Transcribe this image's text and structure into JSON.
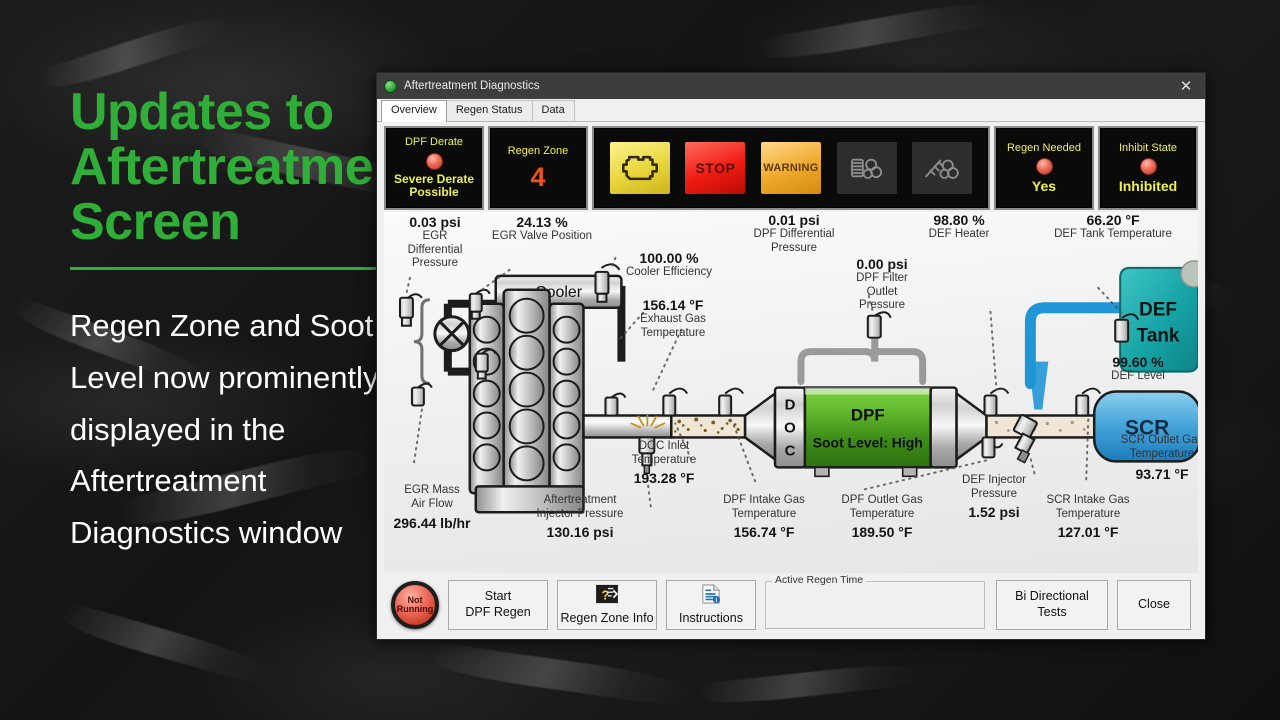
{
  "slide": {
    "headline_lines": [
      "Updates to",
      "Aftertreatment",
      "Screen"
    ],
    "body_lines": [
      "Regen Zone and Soot",
      "Level now prominently",
      "displayed in the",
      "Aftertreatment",
      "Diagnostics window"
    ],
    "accent_color": "#2fae38"
  },
  "window": {
    "title": "Aftertreatment Diagnostics",
    "close_label": "✕",
    "tabs": [
      {
        "label": "Overview",
        "active": true
      },
      {
        "label": "Regen Status",
        "active": false
      },
      {
        "label": "Data",
        "active": false
      }
    ]
  },
  "status_panels": {
    "dpf_derate": {
      "title": "DPF Derate",
      "value_line1": "Severe Derate",
      "value_line2": "Possible"
    },
    "regen_zone": {
      "title": "Regen Zone",
      "value": "4"
    },
    "regen_needed": {
      "title": "Regen Needed",
      "value": "Yes"
    },
    "inhibit_state": {
      "title": "Inhibit State",
      "value": "Inhibited"
    },
    "lamps": [
      {
        "name": "check-engine-lamp",
        "state": "on-yellow",
        "text": ""
      },
      {
        "name": "stop-lamp",
        "state": "on-red",
        "text": "STOP"
      },
      {
        "name": "warning-lamp",
        "state": "on-amber",
        "text": "WARNING"
      },
      {
        "name": "dpf-lamp",
        "state": "off",
        "text": ""
      },
      {
        "name": "high-exhaust-temp-lamp",
        "state": "off",
        "text": ""
      }
    ]
  },
  "diagram": {
    "component_labels": {
      "cooler": "Cooler",
      "doc": "DOC",
      "dpf": "DPF",
      "dpf_soot": "Soot Level: High",
      "scr": "SCR",
      "def_tank_line1": "DEF",
      "def_tank_line2": "Tank"
    },
    "readings": [
      {
        "id": "egr-differential-pressure",
        "value": "0.03 psi",
        "name": "EGR\nDifferential\nPressure"
      },
      {
        "id": "egr-valve-position",
        "value": "24.13 %",
        "name": "EGR Valve Position"
      },
      {
        "id": "cooler-efficiency",
        "value": "100.00 %",
        "name": "Cooler Efficiency"
      },
      {
        "id": "exhaust-gas-temperature",
        "value": "156.14 °F",
        "name": "Exhaust Gas\nTemperature"
      },
      {
        "id": "dpf-differential-pressure",
        "value": "0.01 psi",
        "name": "DPF Differential\nPressure"
      },
      {
        "id": "dpf-filter-outlet-pressure",
        "value": "0.00 psi",
        "name": "DPF Filter\nOutlet\nPressure"
      },
      {
        "id": "def-heater",
        "value": "98.80 %",
        "name": "DEF Heater"
      },
      {
        "id": "def-tank-temperature",
        "value": "66.20 °F",
        "name": "DEF Tank Temperature"
      },
      {
        "id": "def-level",
        "value": "99.60 %",
        "name": "DEF Level"
      },
      {
        "id": "egr-mass-air-flow",
        "value": "296.44 lb/hr",
        "name": "EGR Mass\nAir Flow"
      },
      {
        "id": "aftertreatment-injector-pressure",
        "value": "130.16 psi",
        "name": "Aftertreatment\nInjector Pressure"
      },
      {
        "id": "doc-inlet-temperature",
        "value": "193.28 °F",
        "name": "DOC Inlet\nTemperature"
      },
      {
        "id": "dpf-intake-gas-temperature",
        "value": "156.74 °F",
        "name": "DPF Intake Gas\nTemperature"
      },
      {
        "id": "dpf-outlet-gas-temperature",
        "value": "189.50 °F",
        "name": "DPF Outlet Gas\nTemperature"
      },
      {
        "id": "def-injector-pressure",
        "value": "1.52 psi",
        "name": "DEF Injector\nPressure"
      },
      {
        "id": "scr-intake-gas-temperature",
        "value": "127.01 °F",
        "name": "SCR Intake Gas\nTemperature"
      },
      {
        "id": "scr-outlet-gas-temperature",
        "value": "93.71 °F",
        "name": "SCR Outlet Gas\nTemperature"
      }
    ]
  },
  "buttonbar": {
    "regen_indicator": {
      "line1": "Not",
      "line2": "Running"
    },
    "start_regen_line1": "Start",
    "start_regen_line2": "DPF Regen",
    "regen_zone_info": "Regen Zone Info",
    "instructions": "Instructions",
    "active_regen_time_label": "Active Regen Time",
    "active_regen_time_value": "",
    "bi_directional_line1": "Bi Directional",
    "bi_directional_line2": "Tests",
    "close": "Close"
  }
}
